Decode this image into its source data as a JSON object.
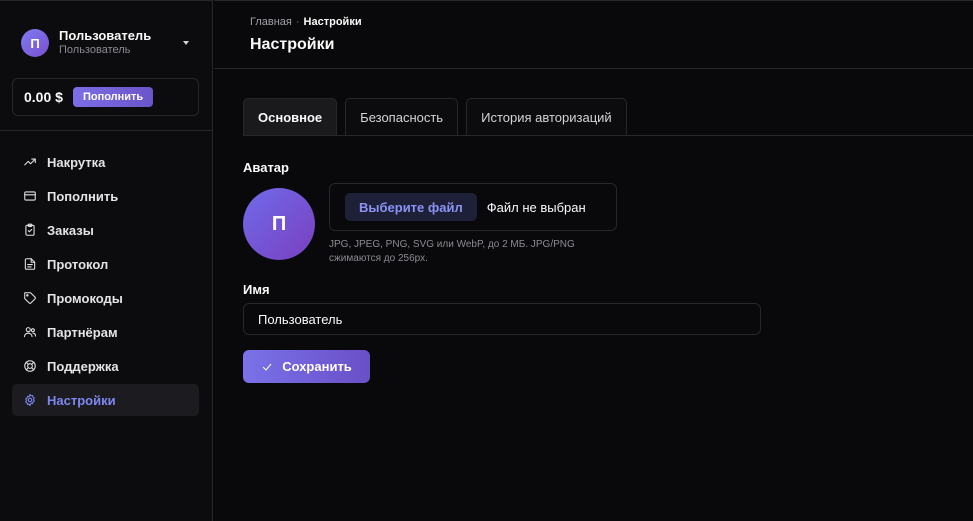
{
  "user": {
    "initial": "П",
    "name": "Пользователь",
    "role": "Пользователь"
  },
  "balance": {
    "amount": "0.00 $",
    "topup_label": "Пополнить"
  },
  "sidebar": {
    "items": [
      {
        "label": "Накрутка",
        "icon": "trending-up-icon"
      },
      {
        "label": "Пополнить",
        "icon": "credit-card-icon"
      },
      {
        "label": "Заказы",
        "icon": "clipboard-icon"
      },
      {
        "label": "Протокол",
        "icon": "file-text-icon"
      },
      {
        "label": "Промокоды",
        "icon": "tag-icon"
      },
      {
        "label": "Партнёрам",
        "icon": "users-icon"
      },
      {
        "label": "Поддержка",
        "icon": "lifebuoy-icon"
      },
      {
        "label": "Настройки",
        "icon": "gear-icon",
        "active": true
      }
    ]
  },
  "header": {
    "breadcrumb": {
      "home": "Главная",
      "separator": "·",
      "current": "Настройки"
    },
    "title": "Настройки"
  },
  "tabs": [
    {
      "label": "Основное",
      "active": true
    },
    {
      "label": "Безопасность"
    },
    {
      "label": "История авторизаций"
    }
  ],
  "form": {
    "avatar_label": "Аватар",
    "avatar_initial": "П",
    "file_button": "Выберите файл",
    "file_status": "Файл не выбран",
    "file_hint": "JPG, JPEG, PNG, SVG или WebP, до 2 МБ. JPG/PNG сжимаются до 256px.",
    "name_label": "Имя",
    "name_value": "Пользователь",
    "save_label": "Сохранить"
  },
  "colors": {
    "accent": "#7f86f0",
    "background": "#09090b",
    "border": "#27272a"
  }
}
